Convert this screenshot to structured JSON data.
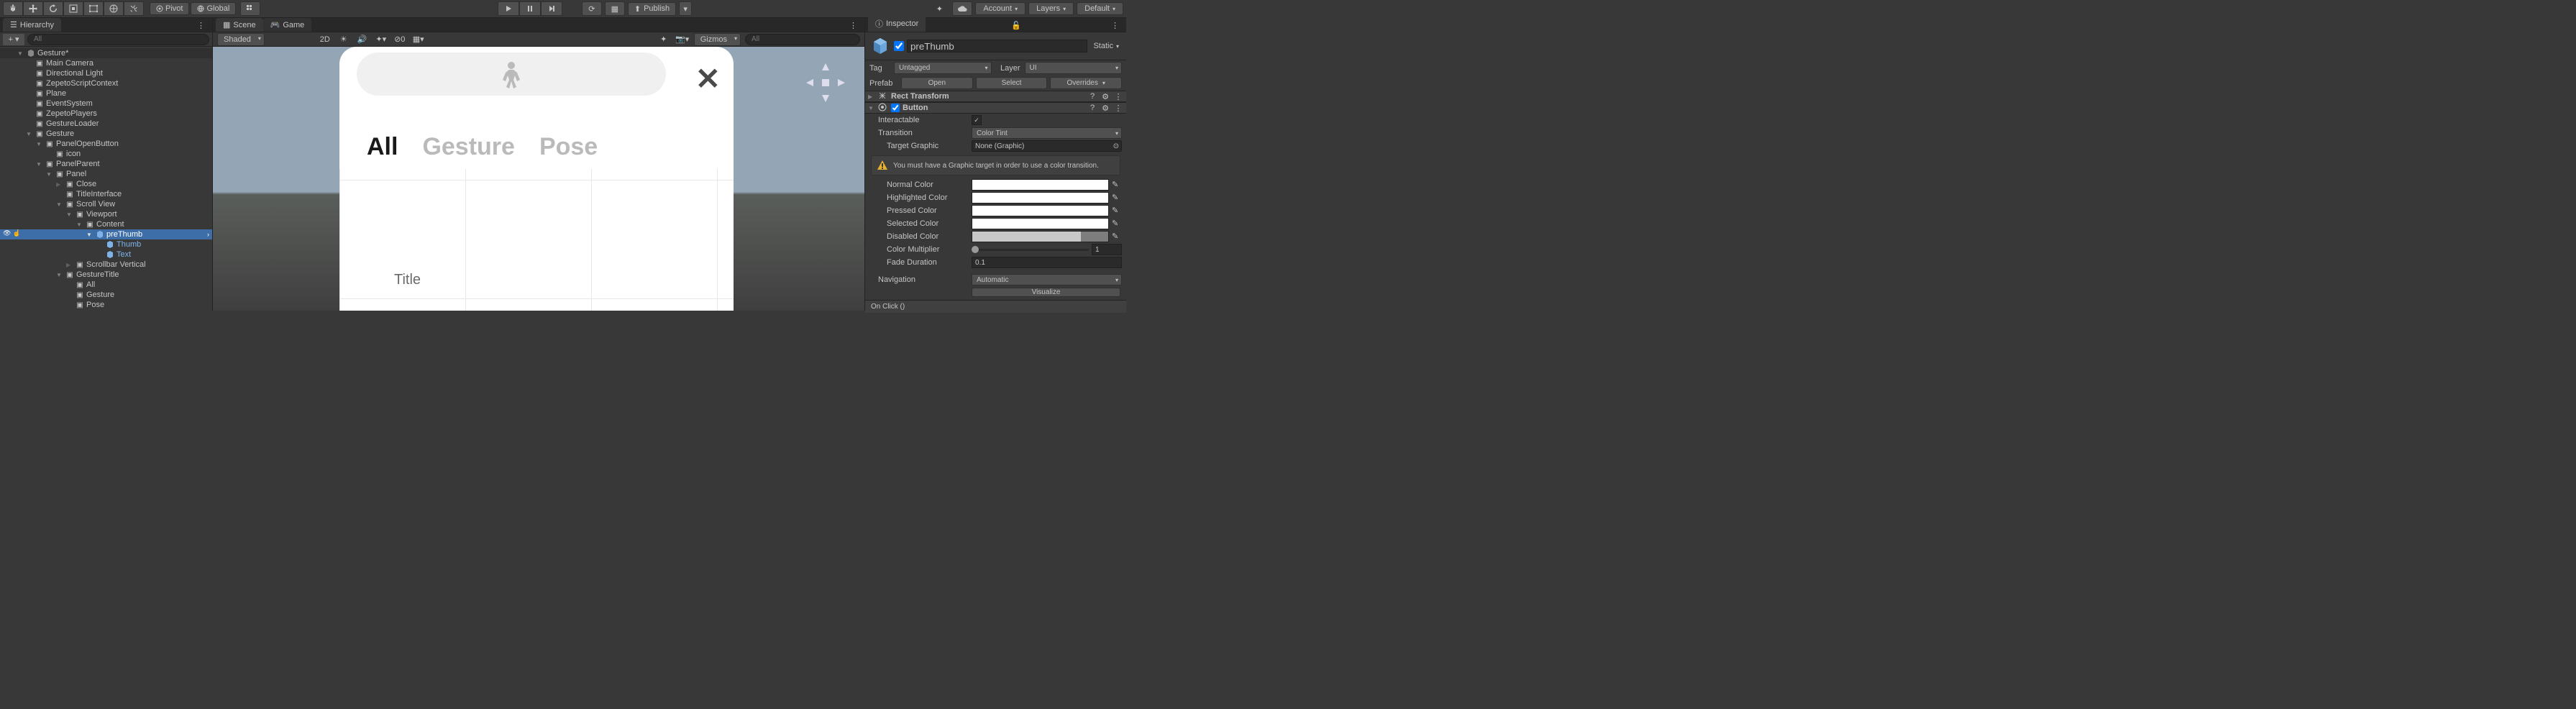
{
  "toolbar": {
    "pivot": "Pivot",
    "global": "Global",
    "publish": "Publish",
    "account": "Account",
    "layers": "Layers",
    "default": "Default"
  },
  "hierarchy": {
    "tab": "Hierarchy",
    "search_placeholder": "All",
    "scene": "Gesture*",
    "items": {
      "camera": "Main Camera",
      "light": "Directional Light",
      "zctx": "ZepetoScriptContext",
      "plane": "Plane",
      "esys": "EventSystem",
      "zplayers": "ZepetoPlayers",
      "gloader": "GestureLoader",
      "gesture": "Gesture",
      "panel_open": "PanelOpenButton",
      "icon": "icon",
      "panel_parent": "PanelParent",
      "panel": "Panel",
      "close": "Close",
      "title_iface": "TitleInterface",
      "scroll": "Scroll View",
      "viewport": "Viewport",
      "content": "Content",
      "prethumb": "preThumb",
      "thumb": "Thumb",
      "text": "Text",
      "scrollbar_v": "Scrollbar Vertical",
      "gtitle": "GestureTitle",
      "all": "All",
      "gesture2": "Gesture",
      "pose": "Pose"
    }
  },
  "scene": {
    "tab_scene": "Scene",
    "tab_game": "Game",
    "shading": "Shaded",
    "mode2d": "2D",
    "gizmos": "Gizmos",
    "search_placeholder": "All"
  },
  "mock": {
    "tab_all": "All",
    "tab_gesture": "Gesture",
    "tab_pose": "Pose",
    "title": "Title"
  },
  "inspector": {
    "tab": "Inspector",
    "name": "preThumb",
    "static": "Static",
    "tag_label": "Tag",
    "tag_value": "Untagged",
    "layer_label": "Layer",
    "layer_value": "UI",
    "prefab_label": "Prefab",
    "open": "Open",
    "select": "Select",
    "overrides": "Overrides",
    "rect_transform": "Rect Transform",
    "button": "Button",
    "interactable": "Interactable",
    "transition": "Transition",
    "transition_value": "Color Tint",
    "target_graphic": "Target Graphic",
    "target_graphic_value": "None (Graphic)",
    "warning": "You must have a Graphic target in order to use a color transition.",
    "normal_color": "Normal Color",
    "highlighted_color": "Highlighted Color",
    "pressed_color": "Pressed Color",
    "selected_color": "Selected Color",
    "disabled_color": "Disabled Color",
    "color_multiplier": "Color Multiplier",
    "color_multiplier_value": "1",
    "fade_duration": "Fade Duration",
    "fade_duration_value": "0.1",
    "navigation": "Navigation",
    "navigation_value": "Automatic",
    "visualize": "Visualize",
    "on_click": "On Click ()"
  }
}
